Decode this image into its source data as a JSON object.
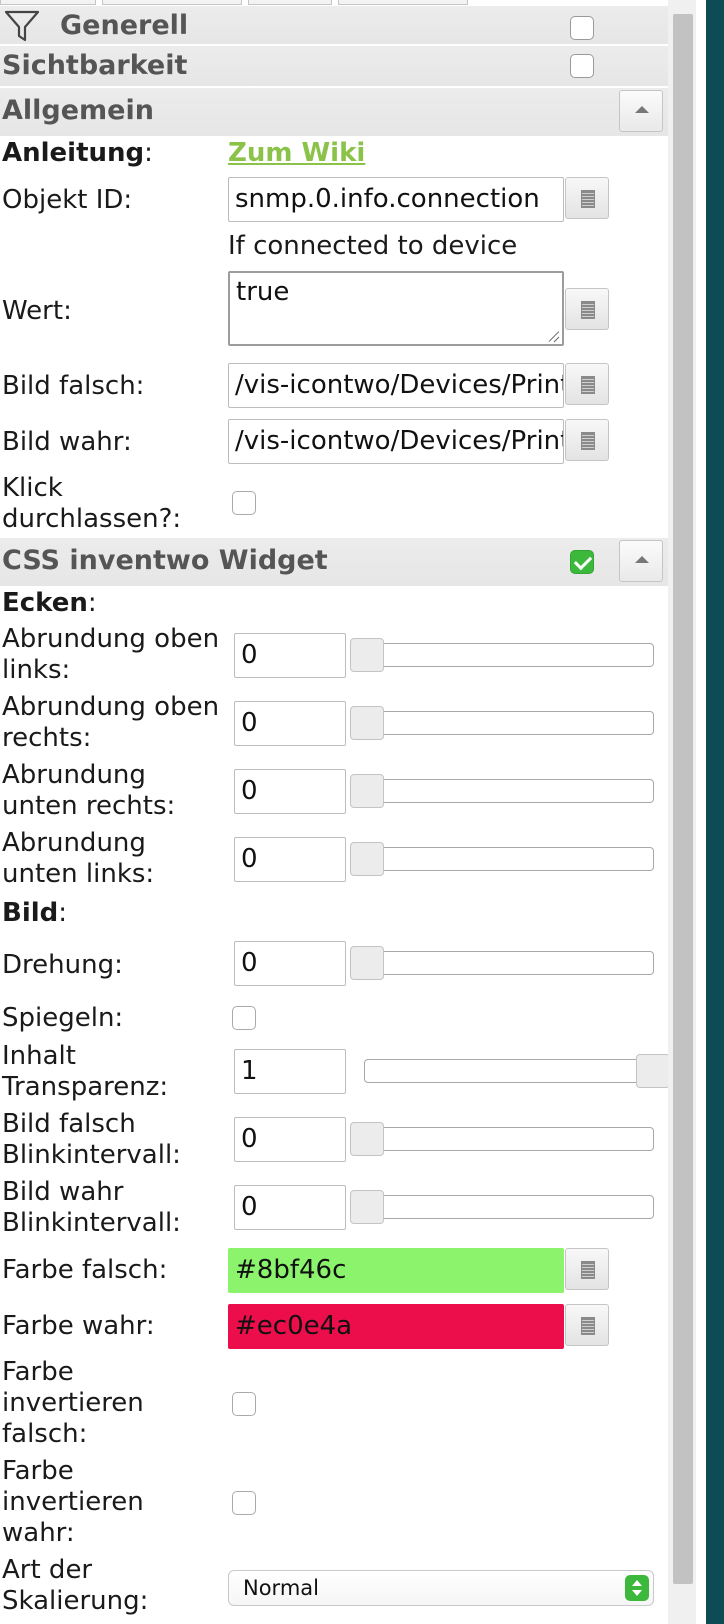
{
  "sections": {
    "generell": "Generell",
    "sichtbarkeit": "Sichtbarkeit",
    "allgemein": "Allgemein",
    "css": "CSS inventwo Widget"
  },
  "allgemein": {
    "anleitung_label": "Anleitung",
    "anleitung_link": "Zum Wiki",
    "objekt_id_label": "Objekt ID:",
    "objekt_id_value": "snmp.0.info.connection",
    "objekt_id_hint": "If connected to device",
    "wert_label": "Wert:",
    "wert_value": "true",
    "bild_falsch_label": "Bild falsch:",
    "bild_falsch_value": "/vis-icontwo/Devices/Printer.svg",
    "bild_wahr_label": "Bild wahr:",
    "bild_wahr_value": "/vis-icontwo/Devices/Printer.svg",
    "klick_label_1": "Klick",
    "klick_label_2": "durchlassen?:"
  },
  "css": {
    "checked": true,
    "ecken_label": "Ecken",
    "r_ol_1": "Abrundung oben",
    "r_ol_2": "links:",
    "r_ol_value": "0",
    "r_or_1": "Abrundung oben",
    "r_or_2": "rechts:",
    "r_or_value": "0",
    "r_ur_1": "Abrundung",
    "r_ur_2": "unten rechts:",
    "r_ur_value": "0",
    "r_ul_1": "Abrundung",
    "r_ul_2": "unten links:",
    "r_ul_value": "0",
    "bild_label": "Bild",
    "drehung_label": "Drehung:",
    "drehung_value": "0",
    "spiegeln_label": "Spiegeln:",
    "inhalt_1": "Inhalt",
    "inhalt_2": "Transparenz:",
    "inhalt_value": "1",
    "bf_blink_1": "Bild falsch",
    "bf_blink_2": "Blinkintervall:",
    "bf_blink_value": "0",
    "bw_blink_1": "Bild wahr",
    "bw_blink_2": "Blinkintervall:",
    "bw_blink_value": "0",
    "farbe_falsch_label": "Farbe falsch:",
    "farbe_falsch_value": "#8bf46c",
    "farbe_wahr_label": "Farbe wahr:",
    "farbe_wahr_value": "#ec0e4a",
    "inv_falsch_1": "Farbe",
    "inv_falsch_2": "invertieren",
    "inv_falsch_3": "falsch:",
    "inv_wahr_1": "Farbe",
    "inv_wahr_2": "invertieren",
    "inv_wahr_3": "wahr:",
    "skal_1": "Art der",
    "skal_2": "Skalierung:",
    "skal_value": "Normal"
  },
  "colors": {
    "link": "#8bc34a",
    "farbe_falsch": "#8bf46c",
    "farbe_wahr": "#ec0e4a",
    "check_green": "#3cb93c"
  },
  "icons": [
    "filter-icon",
    "chevron-up-icon",
    "object-picker-icon",
    "select-arrows-icon"
  ]
}
